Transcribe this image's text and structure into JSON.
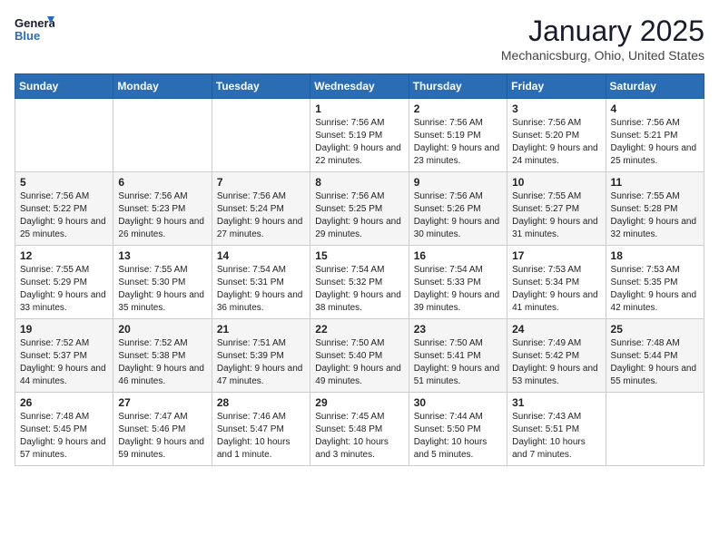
{
  "header": {
    "logo_line1": "General",
    "logo_line2": "Blue",
    "month": "January 2025",
    "location": "Mechanicsburg, Ohio, United States"
  },
  "weekdays": [
    "Sunday",
    "Monday",
    "Tuesday",
    "Wednesday",
    "Thursday",
    "Friday",
    "Saturday"
  ],
  "weeks": [
    [
      {
        "day": "",
        "sunrise": "",
        "sunset": "",
        "daylight": ""
      },
      {
        "day": "",
        "sunrise": "",
        "sunset": "",
        "daylight": ""
      },
      {
        "day": "",
        "sunrise": "",
        "sunset": "",
        "daylight": ""
      },
      {
        "day": "1",
        "sunrise": "Sunrise: 7:56 AM",
        "sunset": "Sunset: 5:19 PM",
        "daylight": "Daylight: 9 hours and 22 minutes."
      },
      {
        "day": "2",
        "sunrise": "Sunrise: 7:56 AM",
        "sunset": "Sunset: 5:19 PM",
        "daylight": "Daylight: 9 hours and 23 minutes."
      },
      {
        "day": "3",
        "sunrise": "Sunrise: 7:56 AM",
        "sunset": "Sunset: 5:20 PM",
        "daylight": "Daylight: 9 hours and 24 minutes."
      },
      {
        "day": "4",
        "sunrise": "Sunrise: 7:56 AM",
        "sunset": "Sunset: 5:21 PM",
        "daylight": "Daylight: 9 hours and 25 minutes."
      }
    ],
    [
      {
        "day": "5",
        "sunrise": "Sunrise: 7:56 AM",
        "sunset": "Sunset: 5:22 PM",
        "daylight": "Daylight: 9 hours and 25 minutes."
      },
      {
        "day": "6",
        "sunrise": "Sunrise: 7:56 AM",
        "sunset": "Sunset: 5:23 PM",
        "daylight": "Daylight: 9 hours and 26 minutes."
      },
      {
        "day": "7",
        "sunrise": "Sunrise: 7:56 AM",
        "sunset": "Sunset: 5:24 PM",
        "daylight": "Daylight: 9 hours and 27 minutes."
      },
      {
        "day": "8",
        "sunrise": "Sunrise: 7:56 AM",
        "sunset": "Sunset: 5:25 PM",
        "daylight": "Daylight: 9 hours and 29 minutes."
      },
      {
        "day": "9",
        "sunrise": "Sunrise: 7:56 AM",
        "sunset": "Sunset: 5:26 PM",
        "daylight": "Daylight: 9 hours and 30 minutes."
      },
      {
        "day": "10",
        "sunrise": "Sunrise: 7:55 AM",
        "sunset": "Sunset: 5:27 PM",
        "daylight": "Daylight: 9 hours and 31 minutes."
      },
      {
        "day": "11",
        "sunrise": "Sunrise: 7:55 AM",
        "sunset": "Sunset: 5:28 PM",
        "daylight": "Daylight: 9 hours and 32 minutes."
      }
    ],
    [
      {
        "day": "12",
        "sunrise": "Sunrise: 7:55 AM",
        "sunset": "Sunset: 5:29 PM",
        "daylight": "Daylight: 9 hours and 33 minutes."
      },
      {
        "day": "13",
        "sunrise": "Sunrise: 7:55 AM",
        "sunset": "Sunset: 5:30 PM",
        "daylight": "Daylight: 9 hours and 35 minutes."
      },
      {
        "day": "14",
        "sunrise": "Sunrise: 7:54 AM",
        "sunset": "Sunset: 5:31 PM",
        "daylight": "Daylight: 9 hours and 36 minutes."
      },
      {
        "day": "15",
        "sunrise": "Sunrise: 7:54 AM",
        "sunset": "Sunset: 5:32 PM",
        "daylight": "Daylight: 9 hours and 38 minutes."
      },
      {
        "day": "16",
        "sunrise": "Sunrise: 7:54 AM",
        "sunset": "Sunset: 5:33 PM",
        "daylight": "Daylight: 9 hours and 39 minutes."
      },
      {
        "day": "17",
        "sunrise": "Sunrise: 7:53 AM",
        "sunset": "Sunset: 5:34 PM",
        "daylight": "Daylight: 9 hours and 41 minutes."
      },
      {
        "day": "18",
        "sunrise": "Sunrise: 7:53 AM",
        "sunset": "Sunset: 5:35 PM",
        "daylight": "Daylight: 9 hours and 42 minutes."
      }
    ],
    [
      {
        "day": "19",
        "sunrise": "Sunrise: 7:52 AM",
        "sunset": "Sunset: 5:37 PM",
        "daylight": "Daylight: 9 hours and 44 minutes."
      },
      {
        "day": "20",
        "sunrise": "Sunrise: 7:52 AM",
        "sunset": "Sunset: 5:38 PM",
        "daylight": "Daylight: 9 hours and 46 minutes."
      },
      {
        "day": "21",
        "sunrise": "Sunrise: 7:51 AM",
        "sunset": "Sunset: 5:39 PM",
        "daylight": "Daylight: 9 hours and 47 minutes."
      },
      {
        "day": "22",
        "sunrise": "Sunrise: 7:50 AM",
        "sunset": "Sunset: 5:40 PM",
        "daylight": "Daylight: 9 hours and 49 minutes."
      },
      {
        "day": "23",
        "sunrise": "Sunrise: 7:50 AM",
        "sunset": "Sunset: 5:41 PM",
        "daylight": "Daylight: 9 hours and 51 minutes."
      },
      {
        "day": "24",
        "sunrise": "Sunrise: 7:49 AM",
        "sunset": "Sunset: 5:42 PM",
        "daylight": "Daylight: 9 hours and 53 minutes."
      },
      {
        "day": "25",
        "sunrise": "Sunrise: 7:48 AM",
        "sunset": "Sunset: 5:44 PM",
        "daylight": "Daylight: 9 hours and 55 minutes."
      }
    ],
    [
      {
        "day": "26",
        "sunrise": "Sunrise: 7:48 AM",
        "sunset": "Sunset: 5:45 PM",
        "daylight": "Daylight: 9 hours and 57 minutes."
      },
      {
        "day": "27",
        "sunrise": "Sunrise: 7:47 AM",
        "sunset": "Sunset: 5:46 PM",
        "daylight": "Daylight: 9 hours and 59 minutes."
      },
      {
        "day": "28",
        "sunrise": "Sunrise: 7:46 AM",
        "sunset": "Sunset: 5:47 PM",
        "daylight": "Daylight: 10 hours and 1 minute."
      },
      {
        "day": "29",
        "sunrise": "Sunrise: 7:45 AM",
        "sunset": "Sunset: 5:48 PM",
        "daylight": "Daylight: 10 hours and 3 minutes."
      },
      {
        "day": "30",
        "sunrise": "Sunrise: 7:44 AM",
        "sunset": "Sunset: 5:50 PM",
        "daylight": "Daylight: 10 hours and 5 minutes."
      },
      {
        "day": "31",
        "sunrise": "Sunrise: 7:43 AM",
        "sunset": "Sunset: 5:51 PM",
        "daylight": "Daylight: 10 hours and 7 minutes."
      },
      {
        "day": "",
        "sunrise": "",
        "sunset": "",
        "daylight": ""
      }
    ]
  ]
}
